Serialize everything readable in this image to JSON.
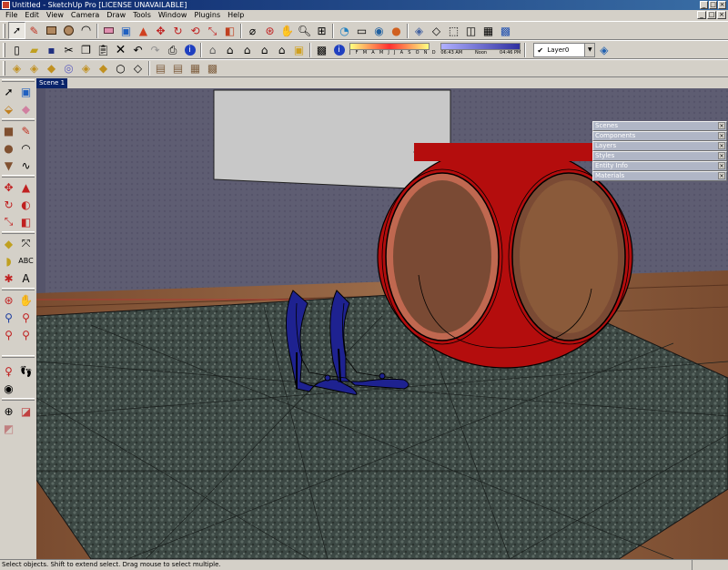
{
  "window": {
    "title": "Untitled - SketchUp Pro [LICENSE UNAVAILABLE]",
    "controls": [
      "_",
      "□",
      "×"
    ]
  },
  "menubar": {
    "items": [
      "File",
      "Edit",
      "View",
      "Camera",
      "Draw",
      "Tools",
      "Window",
      "Plugins",
      "Help"
    ],
    "mdi_controls": [
      "_",
      "□",
      "×"
    ]
  },
  "toolbar1": {
    "icons": [
      "select-icon",
      "pencil-icon",
      "rectangle-icon",
      "circle-icon",
      "arc-icon",
      "eraser-icon",
      "paint-bucket-icon",
      "push-pull-icon",
      "move-icon",
      "rotate-icon",
      "follow-me-icon",
      "scale-icon",
      "offset-icon",
      "tape-measure-icon",
      "orbit-icon",
      "pan-icon",
      "zoom-icon",
      "zoom-extents-icon",
      "get-models-icon",
      "share-model-icon",
      "component-icon",
      "google-earth-icon",
      "iso-view-icon",
      "top-view-icon",
      "front-view-icon",
      "right-view-icon",
      "back-view-icon",
      "left-view-icon"
    ]
  },
  "toolbar2": {
    "icons": [
      "new-icon",
      "open-icon",
      "save-icon",
      "cut-icon",
      "copy-icon",
      "paste-icon",
      "delete-icon",
      "undo-icon",
      "redo-icon",
      "print-icon",
      "model-info-icon",
      "house-icon",
      "house-outline-icon",
      "house-3d-icon",
      "walkthrough-icon",
      "photo-match-icon",
      "section-icon",
      "xray-icon",
      "shadow-settings-icon"
    ],
    "shadow_months": "J F M A M J J A S O N D",
    "time_start": "06:43 AM",
    "time_mid": "Noon",
    "time_end": "04:46 PM",
    "layer": "Layer0",
    "layer_manager_icon": "layer-manager-icon"
  },
  "toolbar3": {
    "icons": [
      "sandbox-contours-icon",
      "sandbox-scratch-icon",
      "smoove-icon",
      "stamp-icon",
      "drape-icon",
      "add-detail-icon",
      "flip-edge-icon",
      "texture-1-icon",
      "texture-2-icon",
      "texture-3-icon",
      "texture-4-icon",
      "texture-5-icon"
    ]
  },
  "scene_tab": "Scene 1",
  "tray": {
    "items": [
      "Scenes",
      "Components",
      "Layers",
      "Styles",
      "Entity Info",
      "Materials"
    ],
    "close": "×"
  },
  "left_toolbar": {
    "icons": [
      "select-icon",
      "component-icon",
      "paint-bucket-icon",
      "eraser-icon",
      "rectangle-icon",
      "line-icon",
      "circle-icon",
      "arc-icon",
      "polygon-icon",
      "freehand-icon",
      "move-icon",
      "push-pull-icon",
      "rotate-icon",
      "follow-me-icon",
      "scale-icon",
      "offset-icon",
      "tape-measure-icon",
      "dimension-icon",
      "protractor-icon",
      "text-icon",
      "axes-icon",
      "3d-text-icon",
      "orbit-icon",
      "pan-icon",
      "zoom-icon",
      "zoom-window-icon",
      "zoom-extents-icon",
      "previous-view-icon",
      "position-camera-icon",
      "walk-icon",
      "look-around-icon",
      "section-plane-icon",
      "section-display-icon"
    ]
  },
  "status": {
    "text": "Select objects. Shift to extend select. Drag mouse to select multiple."
  },
  "scene": {
    "objects": [
      "wall",
      "window-panel",
      "red-ring-stool",
      "blue-high-heels",
      "carpet-rug",
      "wooden-floor"
    ],
    "colors": {
      "wall": "#5e5d72",
      "floor": "#8a5a3a",
      "rug": "#3c4844",
      "stool": "#b40d0d",
      "shoes": "#1e2290",
      "window_panel": "#c8c8c8"
    }
  }
}
